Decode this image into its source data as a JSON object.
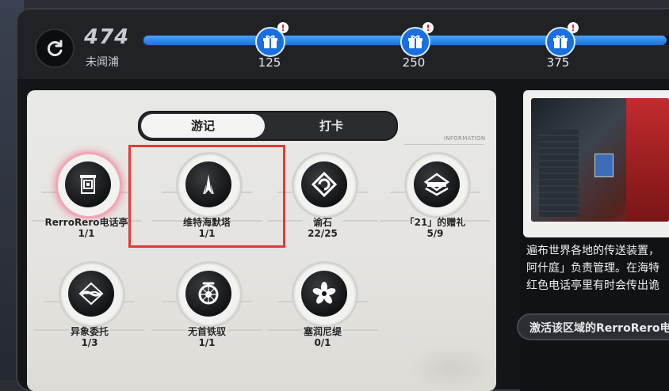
{
  "header": {
    "points": "474",
    "area_name": "未闻浦",
    "progress": 0.97,
    "milestones": [
      {
        "label": "125"
      },
      {
        "label": "250"
      },
      {
        "label": "375"
      }
    ],
    "alert_glyph": "!"
  },
  "tabs": [
    {
      "label": "游记",
      "active": true
    },
    {
      "label": "打卡",
      "active": false
    }
  ],
  "info_tag": "INFORMATION",
  "badges": [
    {
      "name": "RerroRero电话亭",
      "count": "1/1",
      "icon": "phone-booth-icon"
    },
    {
      "name": "维特海默塔",
      "count": "1/1",
      "icon": "tower-icon"
    },
    {
      "name": "谕石",
      "count": "22/25",
      "icon": "oracle-stone-icon"
    },
    {
      "name": "「21」的赠礼",
      "count": "5/9",
      "icon": "gift-emblem-icon"
    },
    {
      "name": "异象委托",
      "count": "1/3",
      "icon": "anomaly-commission-icon"
    },
    {
      "name": "无首铁驭",
      "count": "1/1",
      "icon": "headless-rider-icon"
    },
    {
      "name": "塞润尼缇",
      "count": "0/1",
      "icon": "flower-icon"
    }
  ],
  "detail": {
    "description": "遍布世界各地的传送装置，\n阿什庭」负责管理。在海特\n红色电话亭里有时会传出诡",
    "activate_button": "激活该区域的RerroRero电"
  },
  "colors": {
    "accent_blue": "#1f6fd6",
    "highlight_red": "#e23a3a",
    "glow_pink": "#f06e8c"
  }
}
